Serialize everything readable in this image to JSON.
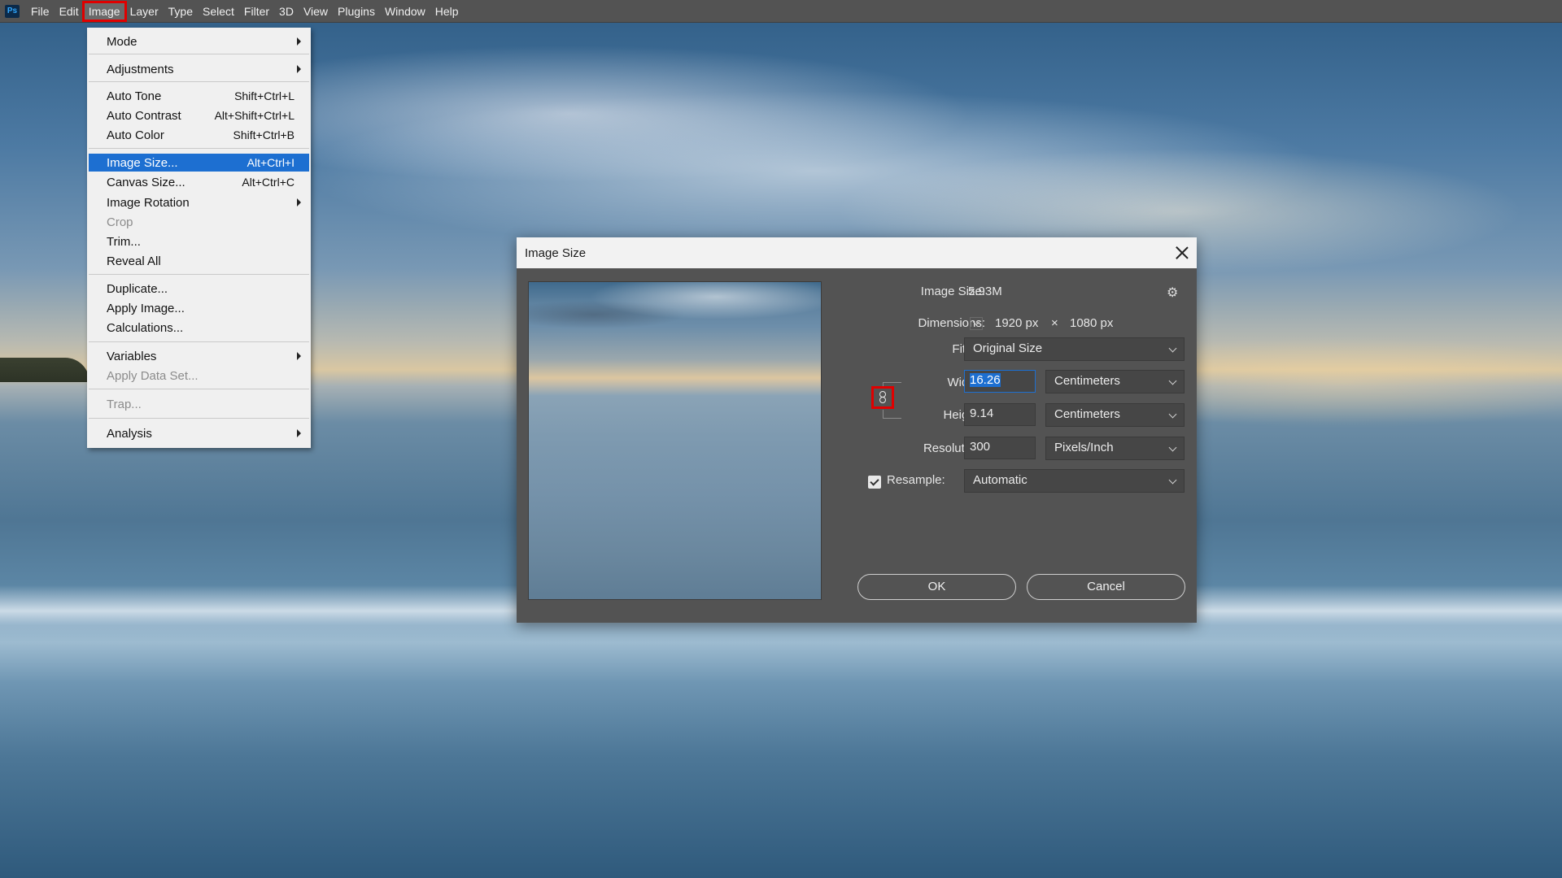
{
  "menubar": {
    "logo": "Ps",
    "items": [
      "File",
      "Edit",
      "Image",
      "Layer",
      "Type",
      "Select",
      "Filter",
      "3D",
      "View",
      "Plugins",
      "Window",
      "Help"
    ],
    "active": "Image"
  },
  "image_menu": {
    "items": [
      {
        "label": "Mode",
        "shortcut": "",
        "submenu": true
      },
      {
        "label": "Adjustments",
        "shortcut": "",
        "submenu": true
      },
      {
        "label": "Auto Tone",
        "shortcut": "Shift+Ctrl+L"
      },
      {
        "label": "Auto Contrast",
        "shortcut": "Alt+Shift+Ctrl+L"
      },
      {
        "label": "Auto Color",
        "shortcut": "Shift+Ctrl+B"
      },
      {
        "label": "Image Size...",
        "shortcut": "Alt+Ctrl+I",
        "selected": true
      },
      {
        "label": "Canvas Size...",
        "shortcut": "Alt+Ctrl+C"
      },
      {
        "label": "Image Rotation",
        "shortcut": "",
        "submenu": true
      },
      {
        "label": "Crop",
        "shortcut": "",
        "disabled": true
      },
      {
        "label": "Trim...",
        "shortcut": ""
      },
      {
        "label": "Reveal All",
        "shortcut": ""
      },
      {
        "label": "Duplicate...",
        "shortcut": ""
      },
      {
        "label": "Apply Image...",
        "shortcut": ""
      },
      {
        "label": "Calculations...",
        "shortcut": ""
      },
      {
        "label": "Variables",
        "shortcut": "",
        "submenu": true
      },
      {
        "label": "Apply Data Set...",
        "shortcut": "",
        "disabled": true
      },
      {
        "label": "Trap...",
        "shortcut": "",
        "disabled": true
      },
      {
        "label": "Analysis",
        "shortcut": "",
        "submenu": true
      }
    ]
  },
  "dialog": {
    "title": "Image Size",
    "image_size_label": "Image Size:",
    "image_size_value": "5.93M",
    "dimensions_label": "Dimensions:",
    "dim_width": "1920 px",
    "dim_x": "×",
    "dim_height": "1080 px",
    "fit_to_label": "Fit To:",
    "fit_to_value": "Original Size",
    "width_label": "Width:",
    "width_value": "16.26",
    "width_unit": "Centimeters",
    "height_label": "Height:",
    "height_value": "9.14",
    "height_unit": "Centimeters",
    "resolution_label": "Resolution:",
    "resolution_value": "300",
    "resolution_unit": "Pixels/Inch",
    "resample_label": "Resample:",
    "resample_checked": true,
    "resample_value": "Automatic",
    "ok_label": "OK",
    "cancel_label": "Cancel"
  },
  "colors": {
    "menubar": "#535353",
    "dialog": "#535353",
    "highlight": "#1d6fd1",
    "annotation_red": "#e00000"
  }
}
